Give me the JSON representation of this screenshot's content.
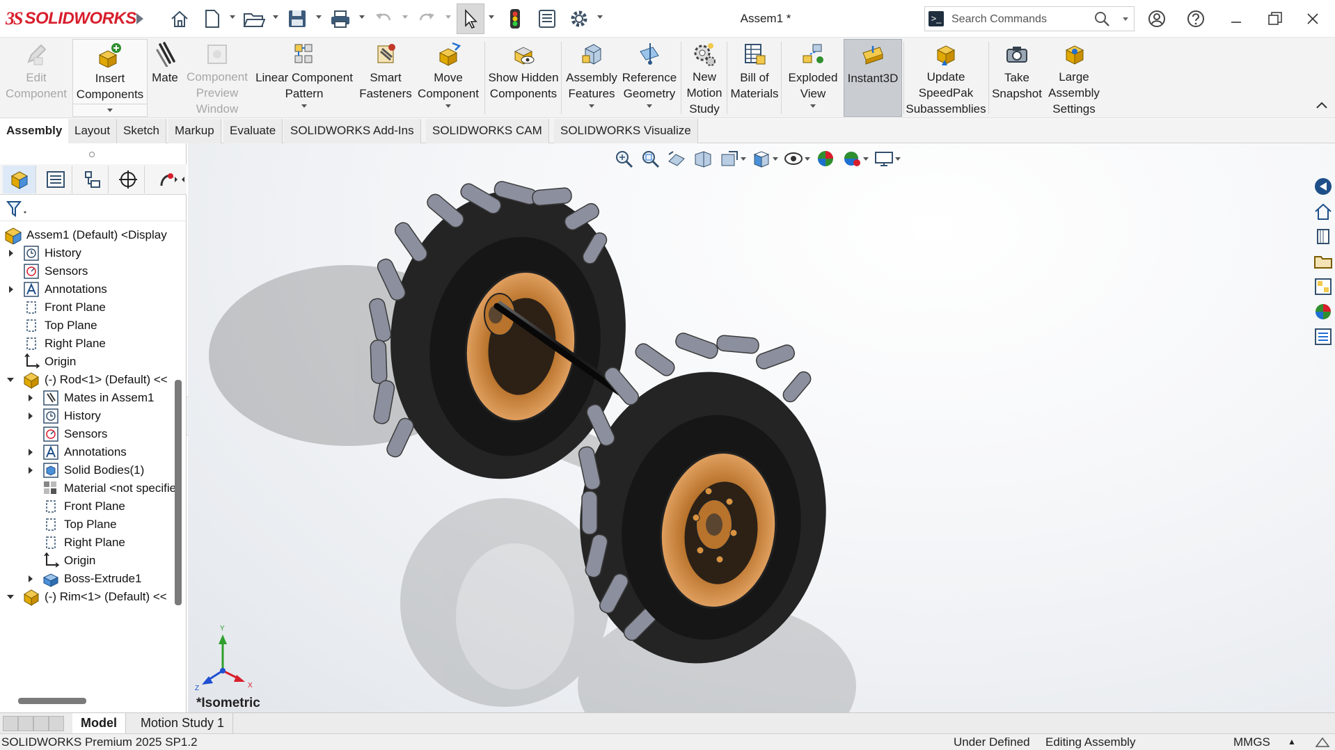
{
  "app": {
    "logo_ds": "3S",
    "logo_name": "SOLIDWORKS",
    "document_title": "Assem1 *"
  },
  "search": {
    "placeholder": "Search Commands"
  },
  "ribbon": {
    "buttons": [
      {
        "label": "Edit Component",
        "icon": "edit-component-icon",
        "state": "disabled"
      },
      {
        "label": "Insert Components",
        "icon": "insert-components-icon",
        "state": "normal"
      },
      {
        "label": "Mate",
        "icon": "mate-icon",
        "state": "normal"
      },
      {
        "label": "Component Preview Window",
        "icon": "component-preview-icon",
        "state": "disabled"
      },
      {
        "label": "Linear Component Pattern",
        "icon": "linear-pattern-icon",
        "state": "normal"
      },
      {
        "label": "Smart Fasteners",
        "icon": "smart-fasteners-icon",
        "state": "normal"
      },
      {
        "label": "Move Component",
        "icon": "move-component-icon",
        "state": "normal"
      },
      {
        "label": "Show Hidden Components",
        "icon": "show-hidden-icon",
        "state": "normal"
      },
      {
        "label": "Assembly Features",
        "icon": "assembly-features-icon",
        "state": "normal"
      },
      {
        "label": "Reference Geometry",
        "icon": "reference-geometry-icon",
        "state": "normal"
      },
      {
        "label": "New Motion Study",
        "icon": "motion-study-icon",
        "state": "normal"
      },
      {
        "label": "Bill of Materials",
        "icon": "bill-of-materials-icon",
        "state": "normal"
      },
      {
        "label": "Exploded View",
        "icon": "exploded-view-icon",
        "state": "normal"
      },
      {
        "label": "Instant3D",
        "icon": "instant3d-icon",
        "state": "pressed"
      },
      {
        "label": "Update SpeedPak Subassemblies",
        "icon": "speedpak-icon",
        "state": "normal"
      },
      {
        "label": "Take Snapshot",
        "icon": "camera-icon",
        "state": "normal"
      },
      {
        "label": "Large Assembly Settings",
        "icon": "large-assembly-icon",
        "state": "normal"
      }
    ]
  },
  "tabs": [
    "Assembly",
    "Layout",
    "Sketch",
    "Markup",
    "Evaluate",
    "SOLIDWORKS Add-Ins",
    "SOLIDWORKS CAM",
    "SOLIDWORKS Visualize"
  ],
  "active_tab": "Assembly",
  "feature_tree": {
    "root": "Assem1 (Default) <Display",
    "items": [
      {
        "label": "History",
        "icon": "history-icon",
        "depth": 1,
        "toggle": "collapsed"
      },
      {
        "label": "Sensors",
        "icon": "sensors-icon",
        "depth": 1,
        "toggle": "none"
      },
      {
        "label": "Annotations",
        "icon": "annotations-icon",
        "depth": 1,
        "toggle": "collapsed"
      },
      {
        "label": "Front Plane",
        "icon": "plane-icon",
        "depth": 1,
        "toggle": "none"
      },
      {
        "label": "Top Plane",
        "icon": "plane-icon",
        "depth": 1,
        "toggle": "none"
      },
      {
        "label": "Right Plane",
        "icon": "plane-icon",
        "depth": 1,
        "toggle": "none"
      },
      {
        "label": "Origin",
        "icon": "origin-icon",
        "depth": 1,
        "toggle": "none"
      },
      {
        "label": "(-) Rod<1> (Default) <<",
        "icon": "part-icon",
        "depth": 0,
        "toggle": "expanded"
      },
      {
        "label": "Mates in Assem1",
        "icon": "mates-icon",
        "depth": 2,
        "toggle": "collapsed"
      },
      {
        "label": "History",
        "icon": "history-icon",
        "depth": 2,
        "toggle": "collapsed"
      },
      {
        "label": "Sensors",
        "icon": "sensors-icon",
        "depth": 2,
        "toggle": "none"
      },
      {
        "label": "Annotations",
        "icon": "annotations-icon",
        "depth": 2,
        "toggle": "collapsed"
      },
      {
        "label": "Solid Bodies(1)",
        "icon": "solid-bodies-icon",
        "depth": 2,
        "toggle": "collapsed"
      },
      {
        "label": "Material <not specified>",
        "icon": "material-icon",
        "depth": 2,
        "toggle": "none"
      },
      {
        "label": "Front Plane",
        "icon": "plane-icon",
        "depth": 2,
        "toggle": "none"
      },
      {
        "label": "Top Plane",
        "icon": "plane-icon",
        "depth": 2,
        "toggle": "none"
      },
      {
        "label": "Right Plane",
        "icon": "plane-icon",
        "depth": 2,
        "toggle": "none"
      },
      {
        "label": "Origin",
        "icon": "origin-icon",
        "depth": 2,
        "toggle": "none"
      },
      {
        "label": "Boss-Extrude1",
        "icon": "extrude-icon",
        "depth": 2,
        "toggle": "collapsed"
      },
      {
        "label": "(-) Rim<1> (Default) <<",
        "icon": "part-icon",
        "depth": 0,
        "toggle": "expanded"
      }
    ]
  },
  "viewport": {
    "view_name": "*Isometric",
    "triad": {
      "x": "X",
      "y": "Y",
      "z": "Z"
    }
  },
  "bottom_tabs": [
    "Model",
    "Motion Study 1"
  ],
  "active_bottom_tab": "Model",
  "status": {
    "product": "SOLIDWORKS Premium 2025 SP1.2",
    "sketch_state": "Under Defined",
    "mode": "Editing Assembly",
    "units": "MMGS"
  },
  "colors": {
    "brand": "#d81e2c",
    "rim": "#b8732c",
    "tire": "#1f1f1f",
    "tread": "#8c8f9e"
  }
}
